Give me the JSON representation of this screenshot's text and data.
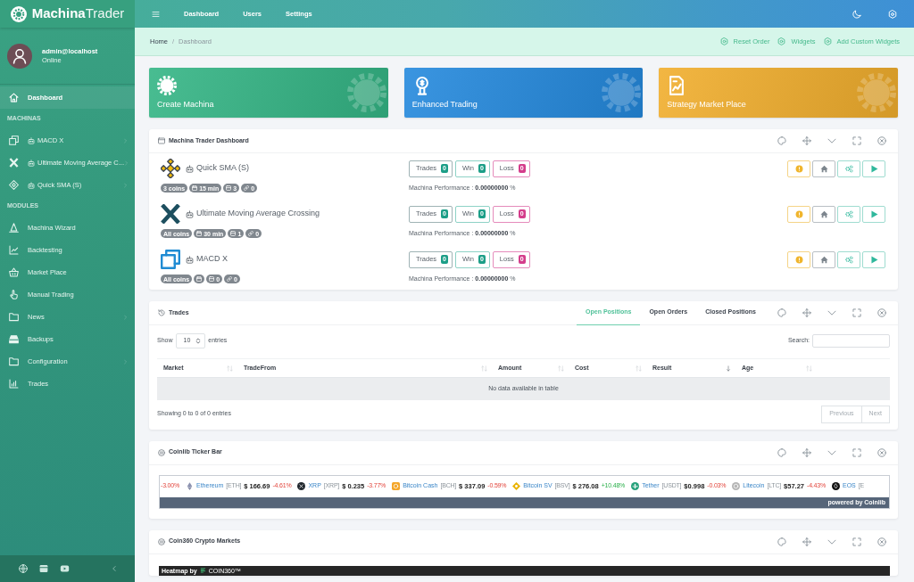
{
  "brand": {
    "name_bold": "Machina",
    "name_light": "Trader"
  },
  "user": {
    "name": "admin@localhost",
    "status": "Online"
  },
  "sidebar": {
    "items": [
      {
        "kind": "link",
        "label": "Dashboard",
        "selected": true,
        "has_children": false
      },
      {
        "kind": "header",
        "label": "MACHINAS"
      },
      {
        "kind": "machina",
        "label": "MACD X",
        "selected": false,
        "has_children": true
      },
      {
        "kind": "machina",
        "label": "Ultimate Moving Average C...",
        "selected": false,
        "has_children": true
      },
      {
        "kind": "machina",
        "label": "Quick SMA (S)",
        "selected": false,
        "has_children": true
      },
      {
        "kind": "header",
        "label": "MODULES"
      },
      {
        "kind": "link",
        "label": "Machina Wizard",
        "selected": false,
        "has_children": false
      },
      {
        "kind": "link",
        "label": "Backtesting",
        "selected": false,
        "has_children": false
      },
      {
        "kind": "link",
        "label": "Market Place",
        "selected": false,
        "has_children": false
      },
      {
        "kind": "link",
        "label": "Manual Trading",
        "selected": false,
        "has_children": false
      },
      {
        "kind": "link",
        "label": "News",
        "selected": false,
        "has_children": true
      },
      {
        "kind": "link",
        "label": "Backups",
        "selected": false,
        "has_children": false
      },
      {
        "kind": "link",
        "label": "Configuration",
        "selected": false,
        "has_children": true
      },
      {
        "kind": "link",
        "label": "Trades",
        "selected": false,
        "has_children": false
      }
    ]
  },
  "topbar": {
    "links": [
      "Dashboard",
      "Users",
      "Settings"
    ]
  },
  "breadcrumb": {
    "items": [
      {
        "label": "Home",
        "current": false
      },
      {
        "label": "Dashboard",
        "current": true
      }
    ],
    "separator": "/",
    "actions": [
      "Reset Order",
      "Widgets",
      "Add Custom Widgets"
    ]
  },
  "cards": [
    {
      "label": "Create Machina",
      "color": "#34b585"
    },
    {
      "label": "Enhanced Trading",
      "color": "#2489dd"
    },
    {
      "label": "Strategy Market Place",
      "color": "#f1ae2d"
    }
  ],
  "dashboard": {
    "title": "Machina Trader Dashboard",
    "machinas": [
      {
        "name": "Quick SMA (S)",
        "counters": [
          {
            "kind": "trades",
            "label": "Trades",
            "value": "0"
          },
          {
            "kind": "win",
            "label": "Win",
            "value": "0"
          },
          {
            "kind": "loss",
            "label": "Loss",
            "value": "0"
          }
        ],
        "tags": [
          {
            "kind": "coins",
            "text": "3 coins"
          },
          {
            "kind": "interval",
            "text": "15 min"
          },
          {
            "kind": "pairs",
            "text": "3"
          },
          {
            "kind": "links",
            "text": "0"
          }
        ],
        "performance": "Machina Performance : **0.00000000** %"
      },
      {
        "name": "Ultimate Moving Average Crossing",
        "counters": [
          {
            "kind": "trades",
            "label": "Trades",
            "value": "0"
          },
          {
            "kind": "win",
            "label": "Win",
            "value": "0"
          },
          {
            "kind": "loss",
            "label": "Loss",
            "value": "0"
          }
        ],
        "tags": [
          {
            "kind": "coins",
            "text": "All coins"
          },
          {
            "kind": "interval",
            "text": "30 min"
          },
          {
            "kind": "pairs",
            "text": "1"
          },
          {
            "kind": "links",
            "text": "0"
          }
        ],
        "performance": "Machina Performance : **0.00000000** %"
      },
      {
        "name": "MACD X",
        "counters": [
          {
            "kind": "trades",
            "label": "Trades",
            "value": "0"
          },
          {
            "kind": "win",
            "label": "Win",
            "value": "0"
          },
          {
            "kind": "loss",
            "label": "Loss",
            "value": "0"
          }
        ],
        "tags": [
          {
            "kind": "coins",
            "text": "All coins"
          },
          {
            "kind": "interval"
          },
          {
            "kind": "pairs",
            "text": "0"
          },
          {
            "kind": "links",
            "text": "0"
          }
        ],
        "performance": "Machina Performance : **0.00000000** %"
      }
    ]
  },
  "trades": {
    "title": "Trades",
    "tabs": [
      {
        "label": "Open Positions",
        "selected": true
      },
      {
        "label": "Open Orders",
        "selected": false
      },
      {
        "label": "Closed Positions",
        "selected": false
      }
    ],
    "show_label": "Show",
    "page_length": "10",
    "entries_label": "entries",
    "search_label": "Search:",
    "columns": [
      {
        "label": "Market",
        "sorted": false
      },
      {
        "label": "TradeFrom",
        "sorted": false
      },
      {
        "label": "Amount",
        "sorted": false
      },
      {
        "label": "Cost",
        "sorted": false
      },
      {
        "label": "Result",
        "sorted": true
      },
      {
        "label": "Age",
        "sorted": false
      }
    ],
    "empty_message": "No data available in table",
    "info": "Showing 0 to 0 of 0 entries",
    "pagination": [
      {
        "label": "Previous",
        "disabled": true
      },
      {
        "label": "Next",
        "disabled": true
      }
    ]
  },
  "ticker": {
    "title": "Coinlib Ticker Bar",
    "items": [
      {
        "change": "-3.00%",
        "rising": false
      },
      {
        "name": "Ethereum",
        "symbol": "[ETH]",
        "price": "$ 166.69",
        "change": "-4.61%",
        "rising": false
      },
      {
        "name": "XRP",
        "symbol": "[XRP]",
        "price": "$ 0.235",
        "change": "-3.77%",
        "rising": false
      },
      {
        "name": "Bitcoin Cash",
        "symbol": "[BCH]",
        "price": "$ 337.09",
        "change": "-0.59%",
        "rising": false
      },
      {
        "name": "Bitcoin SV",
        "symbol": "[BSV]",
        "price": "$ 276.08",
        "change": "+10.48%",
        "rising": true
      },
      {
        "name": "Tether",
        "symbol": "[USDT]",
        "price": "$0.998",
        "change": "-0.03%",
        "rising": false
      },
      {
        "name": "Litecoin",
        "symbol": "[LTC]",
        "price": "$57.27",
        "change": "-4.43%",
        "rising": false
      },
      {
        "name": "EOS",
        "symbol": "[E"
      }
    ],
    "footer": "powered by Coinlib"
  },
  "coin360": {
    "title": "Coin360 Crypto Markets",
    "heatmap_label": "Heatmap by",
    "brand": "COIN360™"
  }
}
